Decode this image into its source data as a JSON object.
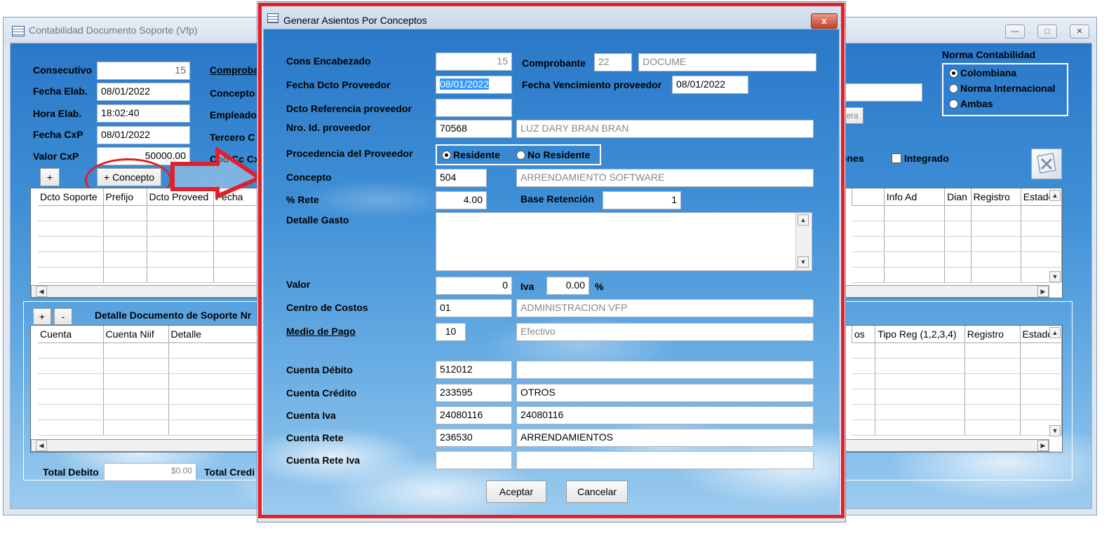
{
  "back": {
    "title": "Contabilidad Documento Soporte (Vfp)",
    "fields": {
      "consecutivo_label": "Consecutivo",
      "consecutivo_value": "15",
      "fecha_elab_label": "Fecha Elab.",
      "fecha_elab_value": "08/01/2022",
      "hora_elab_label": "Hora Elab.",
      "hora_elab_value": "18:02:40",
      "fecha_cxp_label": "Fecha CxP",
      "fecha_cxp_value": "08/01/2022",
      "valor_cxp_label": "Valor CxP",
      "valor_cxp_value": "50000.00",
      "comprobante_label": "Comproba",
      "concepto_label": "Concepto",
      "empleado_label": "Empleado",
      "tercero_label": "Tercero C",
      "cod_cc_label": "Cod Cc Cx"
    },
    "norma": {
      "title": "Norma Contabilidad",
      "options": [
        "Colombiana",
        "Norma Internacional",
        "Ambas"
      ],
      "selected": "Colombiana"
    },
    "integrado_label": "Integrado",
    "ones_label": "ones",
    "era_label": "era",
    "plus_label": "+",
    "minus_label": "-",
    "concepto_button": "+ Concepto",
    "top_grid_cols_left": [
      "Dcto Soporte",
      "Prefijo",
      "Dcto Proveed",
      "Fecha"
    ],
    "top_grid_cols_right": [
      "Info Ad",
      "Dian",
      "Registro",
      "Estado"
    ],
    "detalle_title": "Detalle Documento de Soporte Nr",
    "bottom_grid_cols_left": [
      "Cuenta",
      "Cuenta Niif",
      "Detalle"
    ],
    "bottom_grid_cols_right": [
      "os",
      "Tipo Reg (1,2,3,4)",
      "Registro",
      "Estado"
    ],
    "total_debito_label": "Total Debito",
    "total_debito_value": "$0.00",
    "total_credito_label": "Total Credi"
  },
  "dialog": {
    "title": "Generar Asientos Por Conceptos",
    "close_label": "x",
    "cons_encabezado_label": "Cons Encabezado",
    "cons_encabezado_value": "15",
    "comprobante_label": "Comprobante",
    "comprobante_code": "22",
    "comprobante_name": "DOCUME",
    "fecha_dcto_label": "Fecha Dcto Proveedor",
    "fecha_dcto_value": "08/01/2022",
    "fecha_venc_label": "Fecha Vencimiento proveedor",
    "fecha_venc_value": "08/01/2022",
    "dcto_ref_label": "Dcto Referencia proveedor",
    "dcto_ref_value": "",
    "nro_id_label": "Nro. Id.  proveedor",
    "nro_id_value": "70568",
    "proveedor_name": "LUZ DARY BRAN BRAN",
    "procedencia_label": "Procedencia del Proveedor",
    "procedencia_options": [
      "Residente",
      "No Residente"
    ],
    "procedencia_selected": "Residente",
    "concepto_label": "Concepto",
    "concepto_code": "504",
    "concepto_name": "ARRENDAMIENTO SOFTWARE",
    "rete_label": "% Rete",
    "rete_value": "4.00",
    "base_label": "Base Retención",
    "base_value": "1",
    "detalle_label": "Detalle Gasto",
    "detalle_value": "",
    "valor_label": "Valor",
    "valor_value": "0",
    "iva_label": "Iva",
    "iva_value": "0.00",
    "iva_pct": "%",
    "centro_label": "Centro de Costos",
    "centro_code": "01",
    "centro_name": "ADMINISTRACION VFP",
    "medio_label": "Medio de Pago",
    "medio_code": "10",
    "medio_name": "Efectivo",
    "cta_debito_label": "Cuenta Débito",
    "cta_debito_code": "512012",
    "cta_debito_name": "",
    "cta_credito_label": "Cuenta Crédito",
    "cta_credito_code": "233595",
    "cta_credito_name": "OTROS",
    "cta_iva_label": "Cuenta Iva",
    "cta_iva_code": "24080116",
    "cta_iva_name": "24080116",
    "cta_rete_label": "Cuenta Rete",
    "cta_rete_code": "236530",
    "cta_rete_name": "ARRENDAMIENTOS",
    "cta_rete_iva_label": "Cuenta Rete Iva",
    "cta_rete_iva_code": "",
    "cta_rete_iva_name": "",
    "aceptar_label": "Aceptar",
    "cancelar_label": "Cancelar"
  },
  "colors": {
    "highlight": "#e0202a",
    "selection": "#3399ff"
  }
}
